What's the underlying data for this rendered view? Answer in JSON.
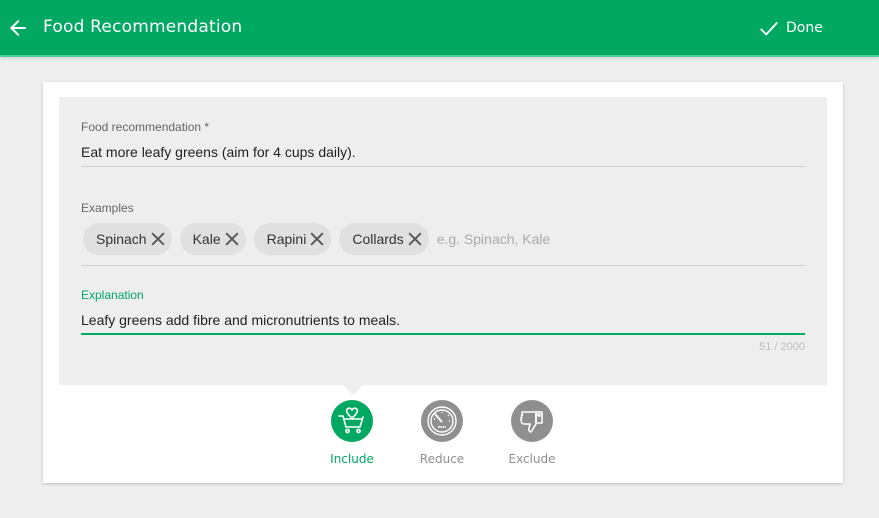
{
  "toolbar": {
    "title": "Food Recommendation",
    "back_icon": "arrow-left-icon",
    "done_label": "Done",
    "done_icon": "check-icon"
  },
  "form": {
    "recommendation": {
      "label": "Food recommendation *",
      "value": "Eat more leafy greens (aim for 4 cups daily)."
    },
    "examples": {
      "label": "Examples",
      "chips": [
        "Spinach",
        "Kale",
        "Rapini",
        "Collards"
      ],
      "chip_remove_icon": "close-icon",
      "placeholder": "e.g. Spinach, Kale"
    },
    "explanation": {
      "label": "Explanation",
      "value": "Leafy greens add fibre and micronutrients to meals.",
      "counter": "51 / 2000"
    }
  },
  "options": [
    {
      "label": "Include",
      "icon": "cart-heart-icon",
      "selected": true,
      "color": "#00a862"
    },
    {
      "label": "Reduce",
      "icon": "speedometer-icon",
      "selected": false,
      "color": "#8f8f8f"
    },
    {
      "label": "Exclude",
      "icon": "thumbs-down-icon",
      "selected": false,
      "color": "#8f8f8f"
    }
  ],
  "colors": {
    "accent": "#00a862",
    "inactive": "#8f8f8f",
    "background": "#eeeeee"
  }
}
